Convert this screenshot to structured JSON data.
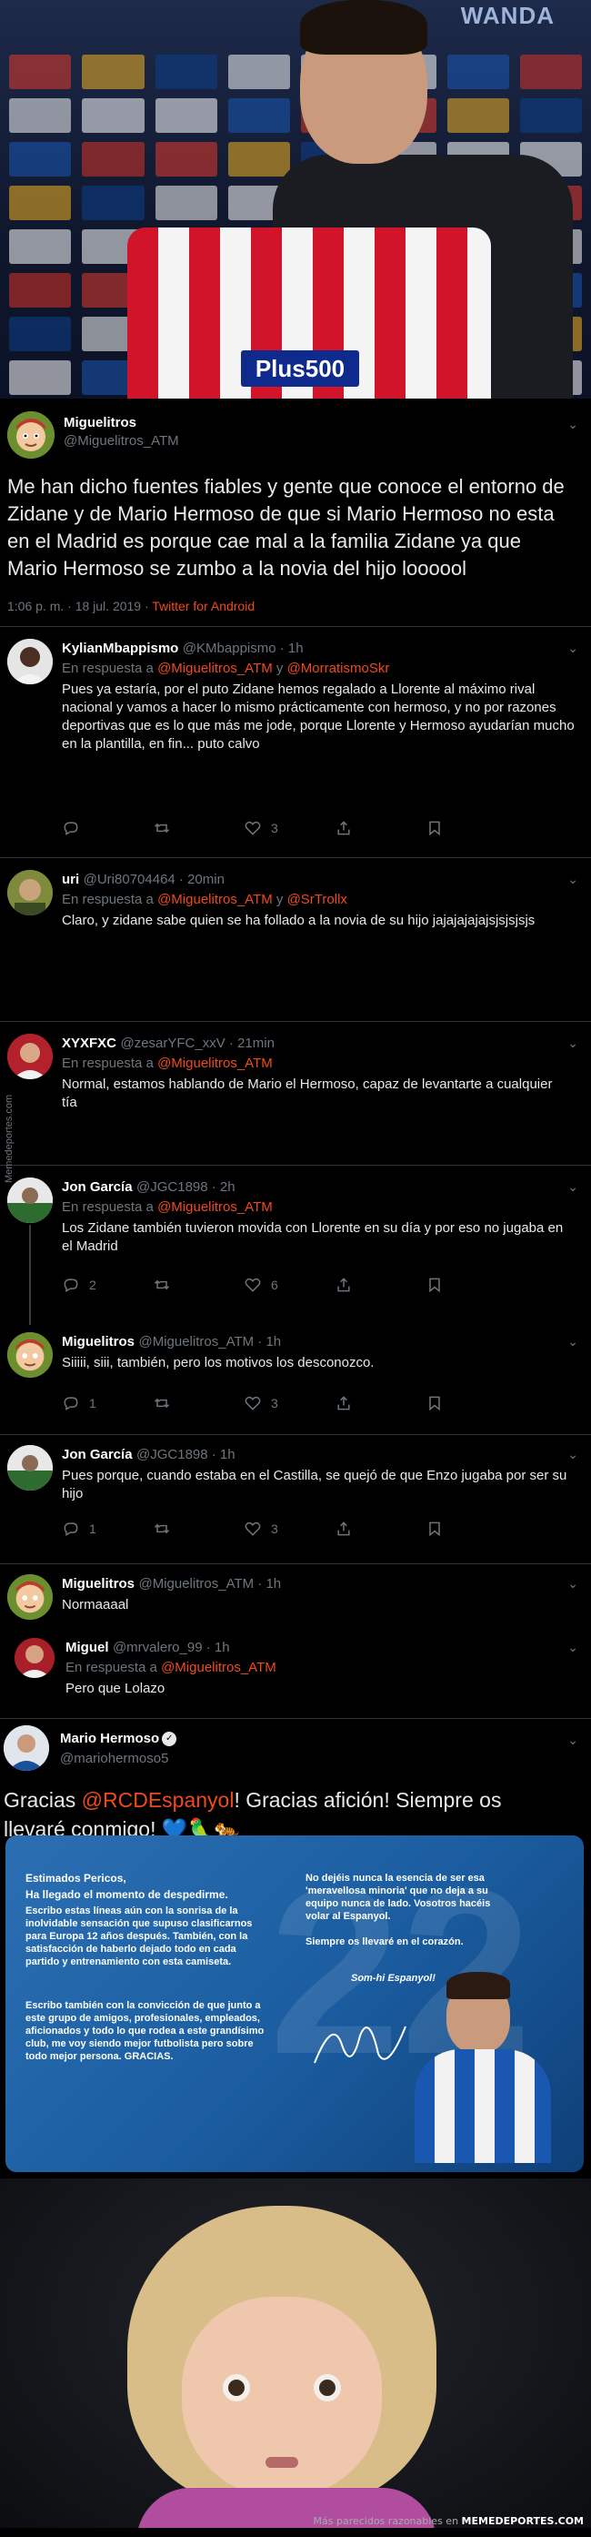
{
  "photo_top": {
    "brand_text": "WANDA",
    "jersey_sponsor": "Plus500",
    "sponsor_colors": [
      "#e23b2e",
      "#f5f5f5",
      "#1a58b5",
      "#f0b323",
      "#ffffff",
      "#d63327",
      "#0c3f8c",
      "#ffffff"
    ]
  },
  "main_tweet": {
    "name": "Miguelitros",
    "handle": "@Miguelitros_ATM",
    "text": "Me han dicho fuentes fiables y gente que conoce el entorno de Zidane y de Mario Hermoso de que si Mario Hermoso no esta en el Madrid es porque cae mal a la familia Zidane ya que Mario Hermoso se zumbo a la novia del hijo loooool",
    "timestamp": "1:06 p. m. · 18 jul. 2019 · ",
    "source": "Twitter for Android"
  },
  "replies": [
    {
      "name": "KylianMbappismo",
      "handle": "@KMbappismo · 1h",
      "reply_to_prefix": "En respuesta a ",
      "reply_to_1": "@Miguelitros_ATM",
      "reply_to_joiner": " y ",
      "reply_to_2": "@MorratismoSkr",
      "text": "Pues ya estaría, por el puto Zidane hemos regalado a Llorente al máximo rival nacional y vamos a hacer lo mismo prácticamente con hermoso, y no por razones deportivas que es lo que más me jode, porque Llorente y Hermoso ayudarían mucho en la plantilla, en fin... puto calvo",
      "replies": "",
      "retweets": "",
      "likes": "3"
    },
    {
      "name": "uri",
      "handle": "@Uri80704464 · 20min",
      "reply_to_prefix": "En respuesta a ",
      "reply_to_1": "@Miguelitros_ATM",
      "reply_to_joiner": " y ",
      "reply_to_2": "@SrTrollx",
      "text": "Claro, y zidane sabe quien se ha follado a la novia de su hijo jajajajajajsjsjsjsjs"
    },
    {
      "name": "XYXFXC",
      "handle": "@zesarYFC_xxV · 21min",
      "reply_to_prefix": "En respuesta a ",
      "reply_to_1": "@Miguelitros_ATM",
      "text": "Normal, estamos hablando de Mario el Hermoso, capaz de levantarte a cualquier tía"
    },
    {
      "name": "Jon García",
      "handle": "@JGC1898 · 2h",
      "reply_to_prefix": "En respuesta a ",
      "reply_to_1": "@Miguelitros_ATM",
      "text": "Los Zidane también tuvieron movida con Llorente en su día y por eso no jugaba en el Madrid",
      "replies": "2",
      "likes": "6"
    },
    {
      "name": "Miguelitros",
      "handle": "@Miguelitros_ATM · 1h",
      "text": "Siiiii, siii, también, pero los motivos los desconozco.",
      "replies": "1",
      "likes": "3"
    },
    {
      "name": "Jon García",
      "handle": "@JGC1898 · 1h",
      "text": "Pues porque, cuando estaba en el Castilla, se quejó de que Enzo jugaba por ser su hijo",
      "replies": "1",
      "likes": "3"
    },
    {
      "name": "Miguelitros",
      "handle": "@Miguelitros_ATM · 1h",
      "text": "Normaaaal"
    },
    {
      "name": "Miguel",
      "handle": "@mrvalero_99 · 1h",
      "reply_to_prefix": "En respuesta a ",
      "reply_to_1": "@Miguelitros_ATM",
      "text": "Pero que Lolazo"
    }
  ],
  "hermoso_tweet": {
    "name": "Mario Hermoso",
    "handle": "@mariohermoso5",
    "text_prefix": "Gracias ",
    "mention": "@RCDEspanyol",
    "text_suffix": "! Gracias afición! Siempre os llevaré conmigo! 💙🦜🐅"
  },
  "letter": {
    "left_1": "Estimados Pericos,",
    "left_2": "Ha llegado el momento de despedirme.",
    "left_3": "Escribo estas líneas aún con la sonrisa de la inolvidable sensación que supuso clasificarnos para Europa 12 años después. También, con la satisfacción de haberlo dejado todo en cada partido y entrenamiento con esta camiseta.",
    "left_4": "Escribo también con la convicción de que junto a este grupo de amigos, profesionales, empleados, aficionados y todo lo que rodea a este grandísimo club, me voy siendo mejor futbolista pero sobre todo mejor persona. GRACIAS.",
    "right_1": "No dejéis nunca la esencia de ser esa 'meravellosa minoria' que no deja a su equipo nunca de lado. Vosotros hacéis volar al Espanyol.",
    "right_2": "Siempre os llevaré en el corazón.",
    "right_3": "Som-hi Espanyol!",
    "number": "22"
  },
  "side_watermark": "Memedeportes.com",
  "footer": {
    "prefix": "Más parecidos razonables en ",
    "site": "MEMEDEPORTES.COM"
  }
}
